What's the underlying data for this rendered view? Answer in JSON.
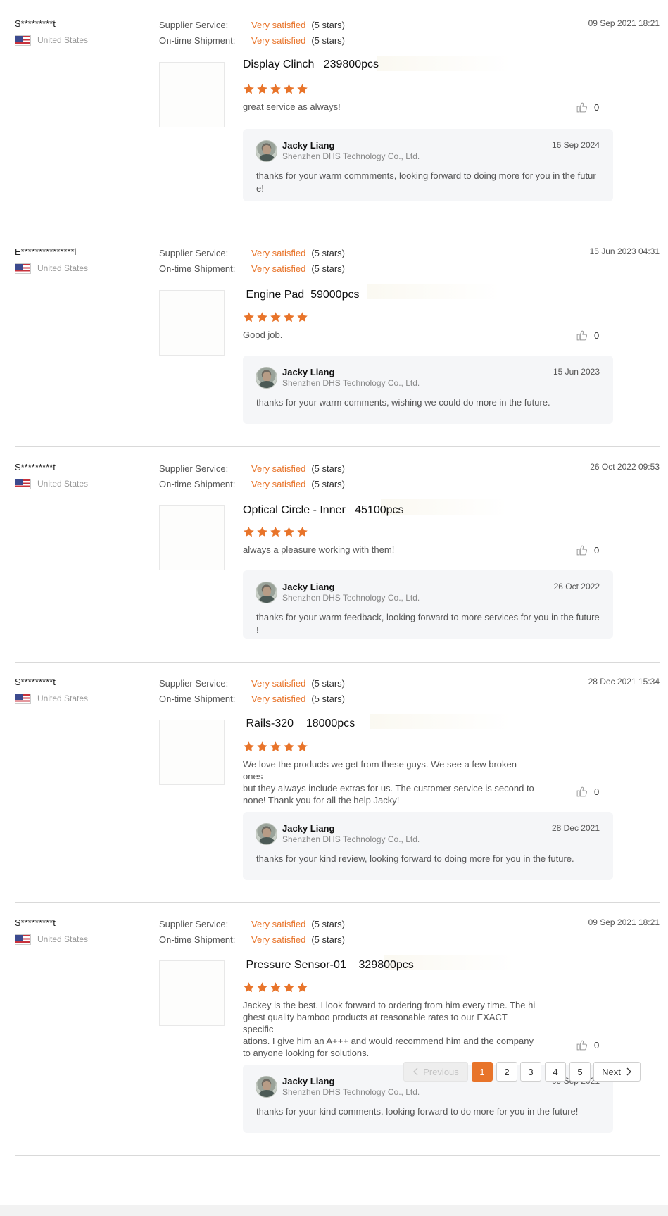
{
  "reviews": [
    {
      "buyer": "S*********t",
      "country": "United States",
      "supplier_service_label": "Supplier Service:",
      "supplier_service_value": "Very satisfied",
      "supplier_service_stars": "(5 stars)",
      "shipment_label": "On-time Shipment:",
      "shipment_value": "Very satisfied",
      "shipment_stars": "(5 stars)",
      "date": "09 Sep 2021 18:21",
      "product": "Display Clinch   239800pcs",
      "rating": 5,
      "comment": "great service as always!",
      "likes": "0",
      "reply": {
        "name": "Jacky Liang",
        "company": "Shenzhen DHS Technology Co., Ltd.",
        "date": "16 Sep 2024",
        "text": "thanks for your warm commments, looking forward to doing more for you in the futur e!"
      }
    },
    {
      "buyer": "E***************l",
      "country": "United States",
      "supplier_service_label": "Supplier Service:",
      "supplier_service_value": "Very satisfied",
      "supplier_service_stars": "(5 stars)",
      "shipment_label": "On-time Shipment:",
      "shipment_value": "Very satisfied",
      "shipment_stars": "(5 stars)",
      "date": "15 Jun 2023 04:31",
      "product": " Engine Pad  59000pcs",
      "rating": 5,
      "comment": "Good job.",
      "likes": "0",
      "reply": {
        "name": "Jacky Liang",
        "company": "Shenzhen DHS Technology Co., Ltd.",
        "date": "15 Jun 2023",
        "text": "thanks for your warm comments, wishing we could do more in the future."
      }
    },
    {
      "buyer": "S*********t",
      "country": "United States",
      "supplier_service_label": "Supplier Service:",
      "supplier_service_value": "Very satisfied",
      "supplier_service_stars": "(5 stars)",
      "shipment_label": "On-time Shipment:",
      "shipment_value": "Very satisfied",
      "shipment_stars": "(5 stars)",
      "date": "26 Oct 2022 09:53",
      "product": "Optical Circle - Inner   45100pcs",
      "rating": 5,
      "comment": "always a pleasure working with them!",
      "likes": "0",
      "reply": {
        "name": "Jacky Liang",
        "company": "Shenzhen DHS Technology Co., Ltd.",
        "date": "26 Oct 2022",
        "text": "thanks for your warm feedback, looking forward to more services for you in the future !"
      }
    },
    {
      "buyer": "S*********t",
      "country": "United States",
      "supplier_service_label": "Supplier Service:",
      "supplier_service_value": "Very satisfied",
      "supplier_service_stars": "(5 stars)",
      "shipment_label": "On-time Shipment:",
      "shipment_value": "Very satisfied",
      "shipment_stars": "(5 stars)",
      "date": "28 Dec 2021 15:34",
      "product": " Rails-320    18000pcs",
      "rating": 5,
      "comment": "We love the products we get from these guys. We see a few broken ones\nbut they always include extras for us.  The customer service is second to\nnone!  Thank you for all the help Jacky!",
      "likes": "0",
      "reply": {
        "name": "Jacky Liang",
        "company": "Shenzhen DHS Technology Co., Ltd.",
        "date": "28 Dec 2021",
        "text": "thanks for your kind review, looking forward to doing more for you in the future."
      }
    },
    {
      "buyer": "S*********t",
      "country": "United States",
      "supplier_service_label": "Supplier Service:",
      "supplier_service_value": "Very satisfied",
      "supplier_service_stars": "(5 stars)",
      "shipment_label": "On-time Shipment:",
      "shipment_value": "Very satisfied",
      "shipment_stars": "(5 stars)",
      "date": "09 Sep 2021 18:21",
      "product": " Pressure Sensor-01    329800pcs",
      "rating": 5,
      "comment": "Jackey is the best.  I look forward to ordering from him every time. The hi\nghest quality bamboo products at reasonable rates to our EXACT specific\nations.   I give him an A+++ and would recommend him and the company\nto anyone looking for solutions.",
      "likes": "0",
      "reply": {
        "name": "Jacky Liang",
        "company": "Shenzhen DHS Technology Co., Ltd.",
        "date": "09 Sep 2021",
        "text": "thanks for your kind comments. looking forward to do more for you in the future!"
      }
    }
  ],
  "pagination": {
    "previous": "Previous",
    "pages": [
      "1",
      "2",
      "3",
      "4",
      "5"
    ],
    "current": "1",
    "next": "Next"
  },
  "colors": {
    "accent": "#e8742a",
    "reply_bg": "#f5f6f8",
    "divider": "#d9d9d9"
  },
  "icons": {
    "flag": "us-flag-icon",
    "star": "star-icon",
    "like": "thumbs-up-icon",
    "prev": "chevron-left-icon",
    "next": "chevron-right-icon"
  }
}
